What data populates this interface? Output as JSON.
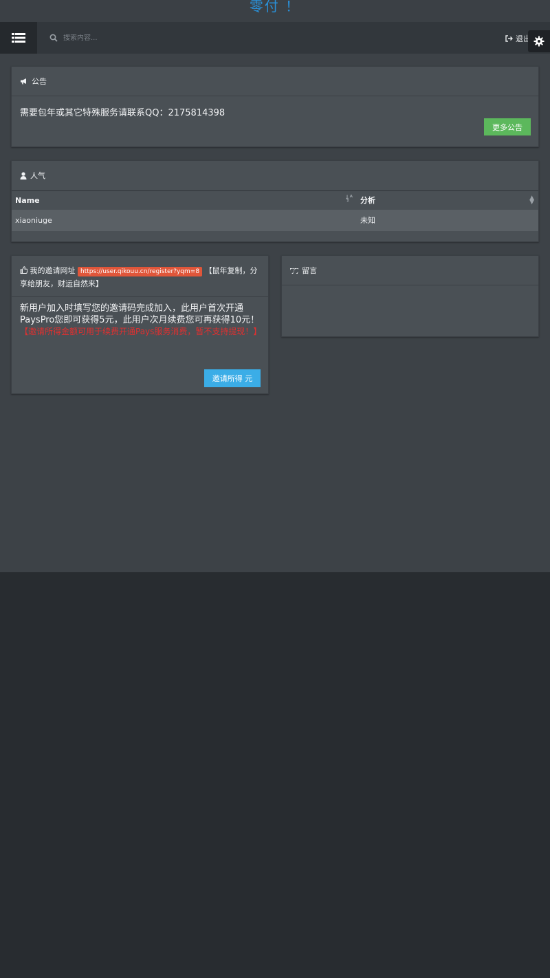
{
  "header": {
    "brand": "零付 ！"
  },
  "navbar": {
    "search_placeholder": "搜索内容...",
    "logout_label": "退出"
  },
  "notice": {
    "title": "公告",
    "text": "需要包年或其它特殊服务请联系QQ：2175814398",
    "more_button": "更多公告"
  },
  "popularity": {
    "title": "人气",
    "columns": [
      "Name",
      "分析"
    ],
    "rows": [
      [
        "xiaoniuge",
        "未知"
      ]
    ]
  },
  "invite": {
    "label": "我的邀请网址",
    "url": "https://user.qikouu.cn/register?yqm=8",
    "hint": "【鼠年复制，分享给朋友，财运自然来】",
    "body": "新用户加入时填写您的邀请码完成加入，此用户首次开通PaysPro您即可获得5元，此用户次月续费您可再获得10元！",
    "warning": "【邀请所得金额可用于续费开通Pays服务消费，暂不支持提现！】",
    "earnings_button": "邀请所得 元"
  },
  "messages": {
    "title": "留言"
  },
  "colors": {
    "brand": "#2a8fd6",
    "success": "#5cb85c",
    "info": "#3bade7",
    "url_badge": "#e0563a",
    "warning_text": "#e03030"
  }
}
